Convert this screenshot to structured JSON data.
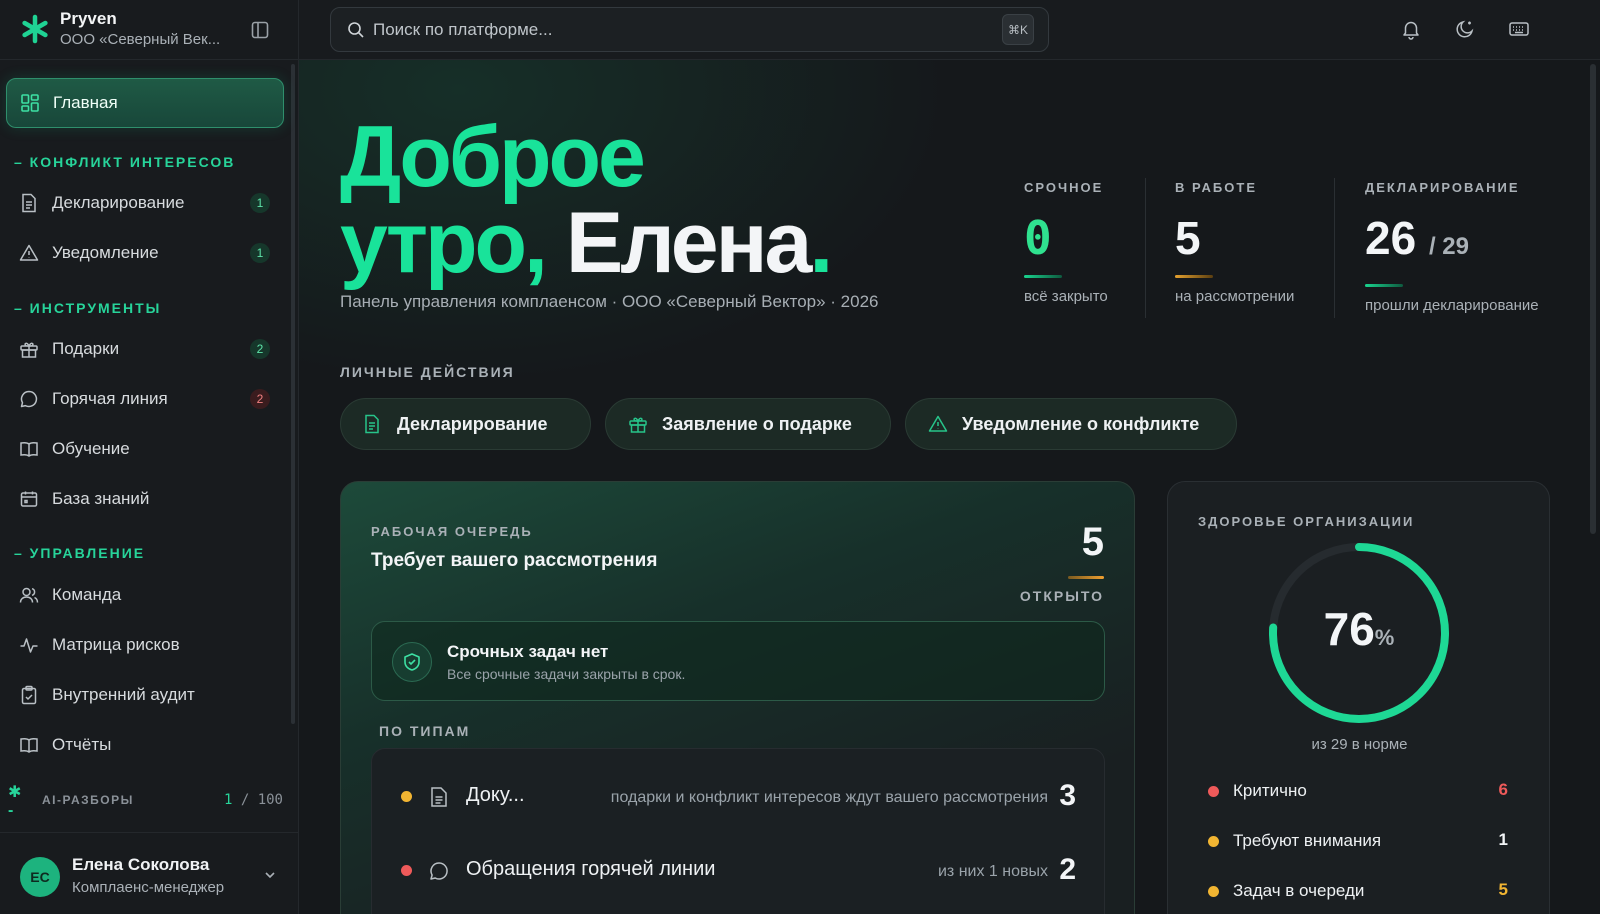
{
  "brand": {
    "name": "Pryven",
    "org": "ООО «Северный Век..."
  },
  "nav": {
    "home": "Главная",
    "sections": [
      {
        "title": "– КОНФЛИКТ ИНТЕРЕСОВ"
      },
      {
        "title": "– ИНСТРУМЕНТЫ"
      },
      {
        "title": "– УПРАВЛЕНИЕ"
      }
    ],
    "items": [
      {
        "label": "Декларирование",
        "badge": "1",
        "badge_color": "green",
        "icon": "document-icon"
      },
      {
        "label": "Уведомление",
        "badge": "1",
        "badge_color": "green",
        "icon": "warning-icon"
      },
      {
        "label": "Подарки",
        "badge": "2",
        "badge_color": "green",
        "icon": "gift-icon"
      },
      {
        "label": "Горячая линия",
        "badge": "2",
        "badge_color": "red",
        "icon": "chat-icon"
      },
      {
        "label": "Обучение",
        "icon": "book-icon"
      },
      {
        "label": "База знаний",
        "icon": "calendar-icon"
      },
      {
        "label": "Команда",
        "icon": "users-icon"
      },
      {
        "label": "Матрица рисков",
        "icon": "pulse-icon"
      },
      {
        "label": "Внутренний аудит",
        "icon": "clipboard-icon"
      },
      {
        "label": "Отчёты",
        "icon": "open-book-icon"
      }
    ]
  },
  "ai": {
    "label": "AI-РАЗБОРЫ",
    "used": "1",
    "sep": " / ",
    "total": "100"
  },
  "user": {
    "initials": "ЕС",
    "name": "Елена Соколова",
    "role": "Комплаенс-менеджер"
  },
  "search": {
    "placeholder": "Поиск по платформе...",
    "shortcut": "⌘K"
  },
  "greeting": {
    "line1": "Доброе",
    "line2a": "утро,",
    "line2b": "Елена",
    "dot": "."
  },
  "subtitle": "Панель управления комплаенсом · ООО «Северный Вектор» · 2026",
  "kpis": [
    {
      "label": "СРОЧНОЕ",
      "value": "0",
      "sub": "всё закрыто",
      "bar_color": "#19d48f"
    },
    {
      "label": "В РАБОТЕ",
      "value": "5",
      "sub": "на рассмотрении",
      "bar_color": "#e5a12f"
    },
    {
      "label": "ДЕКЛАРИРОВАНИЕ",
      "value": "26",
      "total": "/ 29",
      "sub": "прошли декларирование",
      "bar_color": "#19d48f"
    }
  ],
  "actions": {
    "title": "ЛИЧНЫЕ ДЕЙСТВИЯ",
    "items": [
      {
        "label": "Декларирование",
        "icon": "document-icon"
      },
      {
        "label": "Заявление о подарке",
        "icon": "gift-icon"
      },
      {
        "label": "Уведомление о конфликте",
        "icon": "warning-icon"
      }
    ]
  },
  "queue": {
    "overline": "РАБОЧАЯ ОЧЕРЕДЬ",
    "title": "Требует вашего рассмотрения",
    "count": "5",
    "count_label": "ОТКРЫТО",
    "alert_title": "Срочных задач нет",
    "alert_sub": "Все срочные задачи закрыты в срок.",
    "types_title": "ПО ТИПАМ",
    "types": [
      {
        "name": "Доку...",
        "desc": "подарки и конфликт интересов ждут вашего рассмотрения",
        "count": "3",
        "dot": "#f2b532"
      },
      {
        "name": "Обращения горячей линии",
        "desc": "из них 1 новых",
        "count": "2",
        "dot": "#ef5a5a"
      }
    ]
  },
  "health": {
    "title": "ЗДОРОВЬЕ ОРГАНИЗАЦИИ",
    "percent": "76",
    "percent_sign": "%",
    "percent_value": 76,
    "norm": "из 29 в норме",
    "rows": [
      {
        "label": "Критично",
        "value": "6",
        "color": "#ef5a5a"
      },
      {
        "label": "Требуют внимания",
        "value": "1",
        "color": "#f2b532"
      },
      {
        "label": "Задач в очереди",
        "value": "5",
        "color": "#f2b532"
      }
    ]
  },
  "colors": {
    "accent": "#19e39a",
    "warning": "#f2b532",
    "danger": "#ef5a5a"
  }
}
